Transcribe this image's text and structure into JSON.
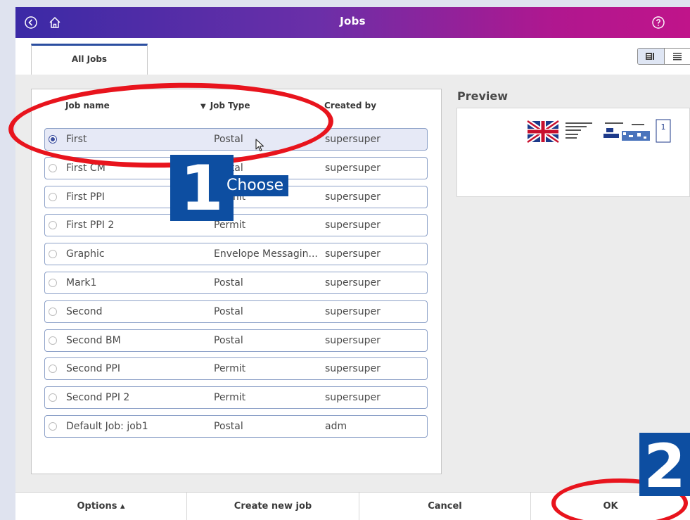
{
  "titlebar": {
    "title": "Jobs",
    "icons": [
      "back-icon",
      "home-icon",
      "help-icon"
    ]
  },
  "tabs": [
    {
      "label": "All Jobs",
      "active": true
    }
  ],
  "view_toggle": {
    "options": [
      "card-view-icon",
      "list-view-icon"
    ],
    "selected": "card-view-icon"
  },
  "table": {
    "headers": {
      "name": "Job name",
      "type": "Job Type",
      "created_by": "Created by"
    },
    "rows": [
      {
        "name": "First",
        "type": "Postal",
        "created_by": "supersuper",
        "selected": true
      },
      {
        "name": "First CM",
        "type": "Postal",
        "created_by": "supersuper",
        "selected": false
      },
      {
        "name": "First PPI",
        "type": "Permit",
        "created_by": "supersuper",
        "selected": false
      },
      {
        "name": "First PPI 2",
        "type": "Permit",
        "created_by": "supersuper",
        "selected": false
      },
      {
        "name": "Graphic",
        "type": "Envelope Messagin...",
        "created_by": "supersuper",
        "selected": false
      },
      {
        "name": "Mark1",
        "type": "Postal",
        "created_by": "supersuper",
        "selected": false
      },
      {
        "name": "Second",
        "type": "Postal",
        "created_by": "supersuper",
        "selected": false
      },
      {
        "name": "Second BM",
        "type": "Postal",
        "created_by": "supersuper",
        "selected": false
      },
      {
        "name": "Second PPI",
        "type": "Permit",
        "created_by": "supersuper",
        "selected": false
      },
      {
        "name": "Second PPI 2",
        "type": "Permit",
        "created_by": "supersuper",
        "selected": false
      },
      {
        "name": "Default Job: job1",
        "type": "Postal",
        "created_by": "adm",
        "selected": false
      }
    ]
  },
  "preview": {
    "label": "Preview"
  },
  "bottom": {
    "options": "Options ▴",
    "create": "Create new job",
    "cancel": "Cancel",
    "ok": "OK"
  },
  "annotations": {
    "step1_number": "1",
    "step1_label": "Choose",
    "step2_number": "2",
    "color": "#e8141d",
    "badge_color": "#0d4ea1"
  }
}
